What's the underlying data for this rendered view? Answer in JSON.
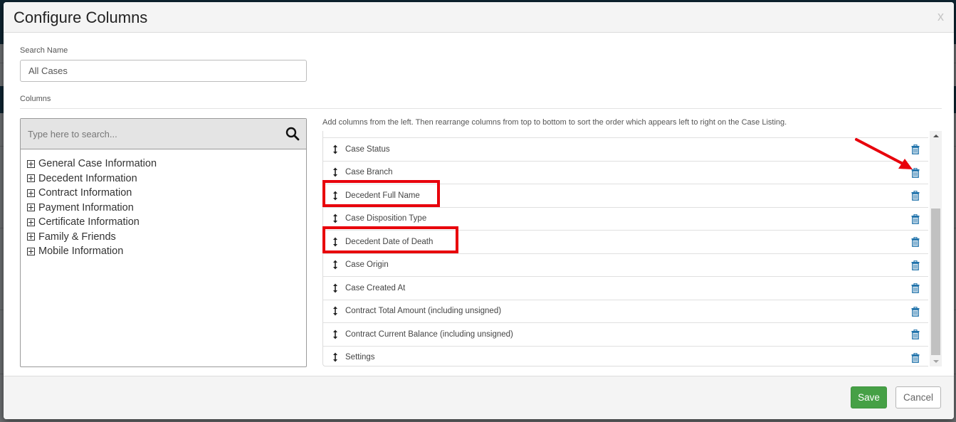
{
  "dialog": {
    "title": "Configure Columns",
    "close_label": "x"
  },
  "search_name": {
    "label": "Search Name",
    "value": "All Cases"
  },
  "columns_section": {
    "label": "Columns",
    "field_search": {
      "placeholder": "Type here to search...",
      "icon": "search-icon"
    },
    "categories": [
      {
        "label": "General Case Information",
        "icon": "expand-plus-icon"
      },
      {
        "label": "Decedent Information",
        "icon": "expand-plus-icon"
      },
      {
        "label": "Contract Information",
        "icon": "expand-plus-icon"
      },
      {
        "label": "Payment Information",
        "icon": "expand-plus-icon"
      },
      {
        "label": "Certificate Information",
        "icon": "expand-plus-icon"
      },
      {
        "label": "Family & Friends",
        "icon": "expand-plus-icon"
      },
      {
        "label": "Mobile Information",
        "icon": "expand-plus-icon"
      }
    ],
    "instructions": "Add columns from the left. Then rearrange columns from top to bottom to sort the order which appears left to right on the Case Listing.",
    "selected_columns": [
      {
        "label": "Case Status",
        "highlighted": false
      },
      {
        "label": "Case Branch",
        "highlighted": false
      },
      {
        "label": "Decedent Full Name",
        "highlighted": true
      },
      {
        "label": "Case Disposition Type",
        "highlighted": false
      },
      {
        "label": "Decedent Date of Death",
        "highlighted": true
      },
      {
        "label": "Case Origin",
        "highlighted": false
      },
      {
        "label": "Case Created At",
        "highlighted": false
      },
      {
        "label": "Contract Total Amount (including unsigned)",
        "highlighted": false
      },
      {
        "label": "Contract Current Balance (including unsigned)",
        "highlighted": false
      },
      {
        "label": "Settings",
        "highlighted": false
      }
    ]
  },
  "footer": {
    "save_label": "Save",
    "cancel_label": "Cancel"
  },
  "colors": {
    "save_button": "#46a046",
    "trash_icon": "#1a6fa8",
    "annotation": "#e8000b",
    "header_bg": "#f4f4f4"
  }
}
